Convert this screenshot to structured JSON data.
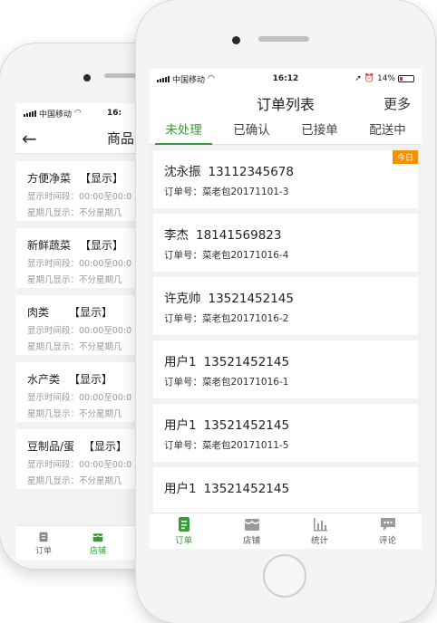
{
  "back_phone": {
    "status": {
      "carrier": "中国移动",
      "time": "16:"
    },
    "nav": {
      "back_icon": "back-arrow-icon",
      "title": "商品分"
    },
    "categories": [
      {
        "name": "方便净菜",
        "tag": "【显示】",
        "time_label": "显示时间段：00:00至00:0",
        "week_label": "星期几显示：不分星期几"
      },
      {
        "name": "新鲜蔬菜",
        "tag": "【显示】",
        "time_label": "显示时间段：00:00至00:0",
        "week_label": "星期几显示：不分星期几"
      },
      {
        "name": "肉类",
        "tag": "【显示】",
        "time_label": "显示时间段：00:00至00:0",
        "week_label": "星期几显示：不分星期几"
      },
      {
        "name": "水产类",
        "tag": "【显示】",
        "time_label": "显示时间段：00:00至00:0",
        "week_label": "星期几显示：不分星期几"
      },
      {
        "name": "豆制品/蛋",
        "tag": "【显示】",
        "time_label": "显示时间段：00:00至00:0",
        "week_label": "星期几显示：不分星期几"
      }
    ],
    "tabbar": [
      {
        "label": "订单",
        "icon": "order-icon",
        "active": false
      },
      {
        "label": "店铺",
        "icon": "store-icon",
        "active": true
      }
    ]
  },
  "front_phone": {
    "status": {
      "carrier": "中国移动",
      "time": "16:12",
      "battery": "14%"
    },
    "nav": {
      "title": "订单列表",
      "more": "更多"
    },
    "tabs": [
      {
        "label": "未处理",
        "active": true
      },
      {
        "label": "已确认",
        "active": false
      },
      {
        "label": "已接单",
        "active": false
      },
      {
        "label": "配送中",
        "active": false
      }
    ],
    "orders": [
      {
        "name": "沈永振",
        "phone": "13112345678",
        "order_label": "订单号：",
        "order_no": "菜老包20171101-3",
        "badge": "今日"
      },
      {
        "name": "李杰",
        "phone": "18141569823",
        "order_label": "订单号：",
        "order_no": "菜老包20171016-4",
        "badge": ""
      },
      {
        "name": "许克帅",
        "phone": "13521452145",
        "order_label": "订单号：",
        "order_no": "菜老包20171016-2",
        "badge": ""
      },
      {
        "name": "用户1",
        "phone": "13521452145",
        "order_label": "订单号：",
        "order_no": "菜老包20171016-1",
        "badge": ""
      },
      {
        "name": "用户1",
        "phone": "13521452145",
        "order_label": "订单号：",
        "order_no": "菜老包20171011-5",
        "badge": ""
      },
      {
        "name": "用户1",
        "phone": "13521452145",
        "order_label": "",
        "order_no": "",
        "badge": ""
      }
    ],
    "tabbar": [
      {
        "label": "订单",
        "icon": "order-icon",
        "active": true
      },
      {
        "label": "店铺",
        "icon": "store-icon",
        "active": false
      },
      {
        "label": "统计",
        "icon": "stats-icon",
        "active": false
      },
      {
        "label": "评论",
        "icon": "comment-icon",
        "active": false
      }
    ]
  },
  "colors": {
    "accent": "#3a9b3a",
    "badge": "#f39200"
  }
}
